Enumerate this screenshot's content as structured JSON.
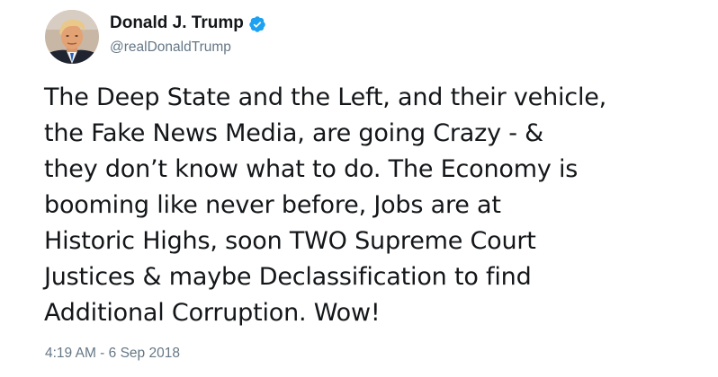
{
  "author": {
    "display_name": "Donald J. Trump",
    "handle": "@realDonaldTrump",
    "verified": true,
    "avatar_icon": "profile-photo-icon"
  },
  "tweet": {
    "lines": [
      "The Deep State and the Left, and their vehicle,",
      "the Fake News Media, are going Crazy - &",
      "they don’t know what to do. The Economy is",
      "booming like never before, Jobs are at",
      "Historic Highs, soon TWO Supreme Court",
      "Justices & maybe Declassification to find",
      "Additional Corruption. Wow!"
    ],
    "timestamp": "4:19 AM - 6 Sep 2018"
  },
  "colors": {
    "text": "#14171a",
    "secondary": "#657786",
    "verified_badge": "#1da1f2"
  }
}
